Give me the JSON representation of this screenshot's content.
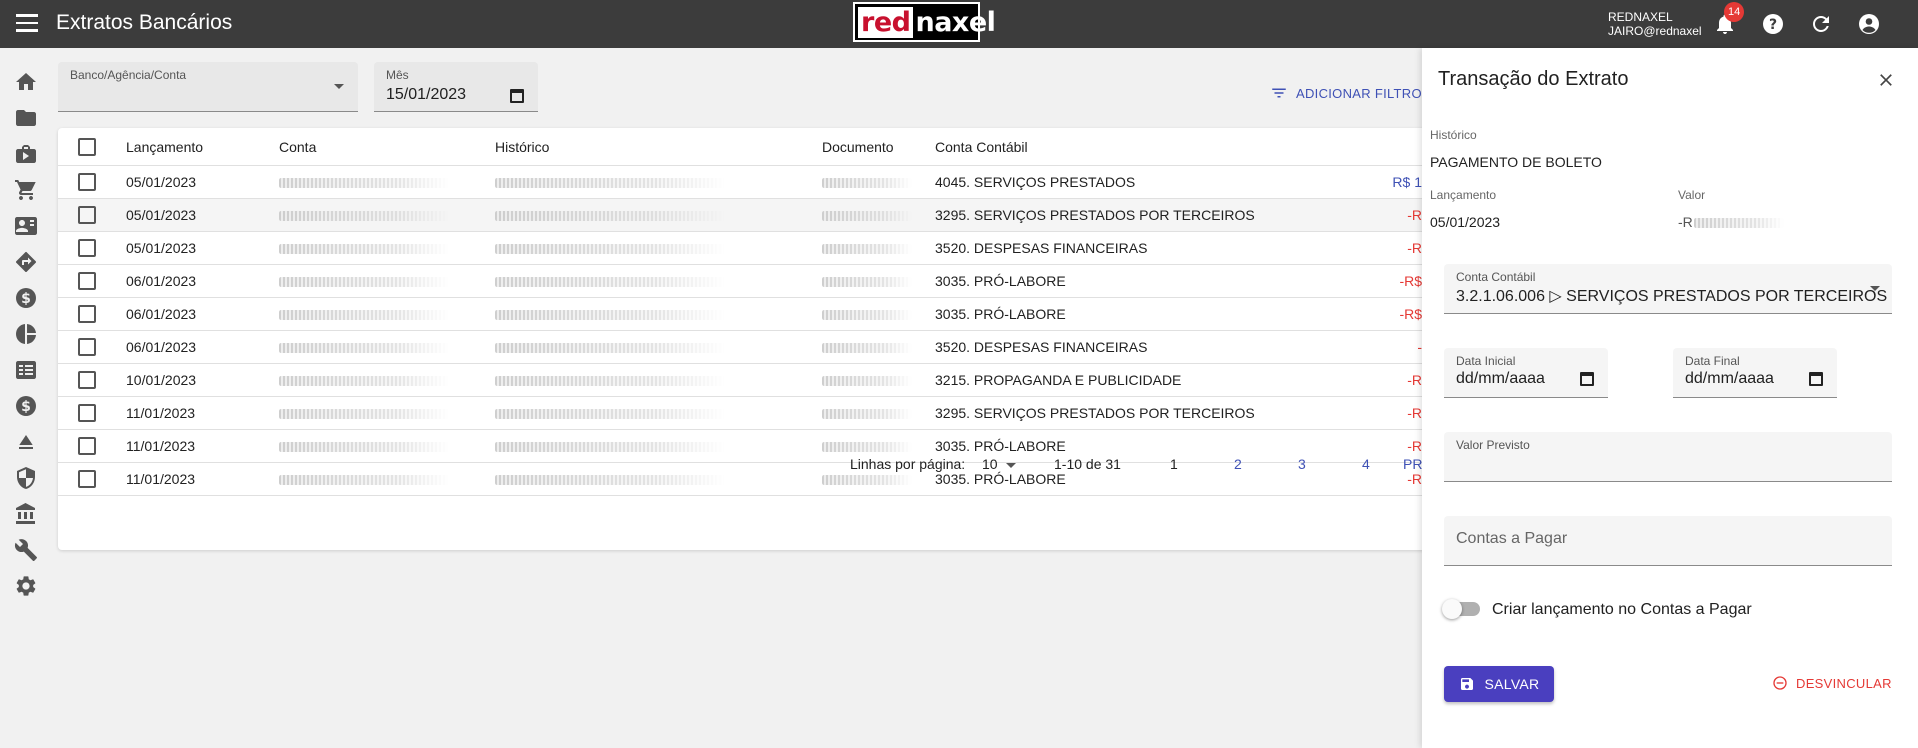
{
  "app": {
    "title": "Extratos Bancários",
    "logo_red": "red",
    "logo_rest": "naxel",
    "user_company": "REDNAXEL",
    "user_email": "JAIRO@rednaxel",
    "notification_count": "14"
  },
  "nav": {
    "icons": [
      "home-icon",
      "folder-icon",
      "briefcase-icon",
      "cart-icon",
      "contact-card-icon",
      "directions-icon",
      "dollar-circle-icon",
      "pie-chart-icon",
      "list-alt-icon",
      "dollar-circle-icon",
      "eject-icon",
      "shield-icon",
      "bank-icon",
      "wrench-icon",
      "gear-icon"
    ]
  },
  "filters": {
    "bank_label": "Banco/Agência/Conta",
    "bank_value": "",
    "month_label": "Mês",
    "month_value": "15/01/2023",
    "add_filter": "ADICIONAR FILTRO"
  },
  "table": {
    "columns": [
      "Lançamento",
      "Conta",
      "Histórico",
      "Documento",
      "Conta Contábil"
    ],
    "rows": [
      {
        "date": "05/01/2023",
        "account": "4045. SERVIÇOS PRESTADOS",
        "amount": "R$ 1",
        "positive": true
      },
      {
        "date": "05/01/2023",
        "account": "3295. SERVIÇOS PRESTADOS POR TERCEIROS",
        "amount": "-R",
        "positive": false
      },
      {
        "date": "05/01/2023",
        "account": "3520. DESPESAS FINANCEIRAS",
        "amount": "-R",
        "positive": false
      },
      {
        "date": "06/01/2023",
        "account": "3035. PRÓ-LABORE",
        "amount": "-R$",
        "positive": false
      },
      {
        "date": "06/01/2023",
        "account": "3035. PRÓ-LABORE",
        "amount": "-R$",
        "positive": false
      },
      {
        "date": "06/01/2023",
        "account": "3520. DESPESAS FINANCEIRAS",
        "amount": "-",
        "positive": false
      },
      {
        "date": "10/01/2023",
        "account": "3215. PROPAGANDA E PUBLICIDADE",
        "amount": "-R",
        "positive": false
      },
      {
        "date": "11/01/2023",
        "account": "3295. SERVIÇOS PRESTADOS POR TERCEIROS",
        "amount": "-R",
        "positive": false
      },
      {
        "date": "11/01/2023",
        "account": "3035. PRÓ-LABORE",
        "amount": "-R",
        "positive": false
      },
      {
        "date": "11/01/2023",
        "account": "3035. PRÓ-LABORE",
        "amount": "-R",
        "positive": false
      }
    ]
  },
  "pagination": {
    "rows_per_page_label": "Linhas por página:",
    "rows_per_page": "10",
    "range": "1-10 de 31",
    "pages": [
      "1",
      "2",
      "3",
      "4"
    ],
    "next_partial": "PR"
  },
  "panel": {
    "title": "Transação do Extrato",
    "historico_label": "Histórico",
    "historico_value": "PAGAMENTO DE BOLETO",
    "lancamento_label": "Lançamento",
    "lancamento_value": "05/01/2023",
    "valor_label": "Valor",
    "valor_value": "-R",
    "conta_contabil_label": "Conta Contábil",
    "conta_contabil_value": "3.2.1.06.006 ▷ SERVIÇOS PRESTADOS POR TERCEIROS",
    "data_inicial_label": "Data Inicial",
    "data_inicial_value": "dd/mm/aaaa",
    "data_final_label": "Data Final",
    "data_final_value": "dd/mm/aaaa",
    "valor_previsto_label": "Valor Previsto",
    "valor_previsto_value": "",
    "contas_pagar_placeholder": "Contas a Pagar",
    "toggle_label": "Criar lançamento no Contas a Pagar",
    "toggle_on": false,
    "save_label": "SALVAR",
    "unlink_label": "DESVINCULAR"
  },
  "colors": {
    "topbar": "#3c3c3c",
    "primary": "#4a3fbf",
    "link": "#3f51b5",
    "negative": "#e53935"
  }
}
